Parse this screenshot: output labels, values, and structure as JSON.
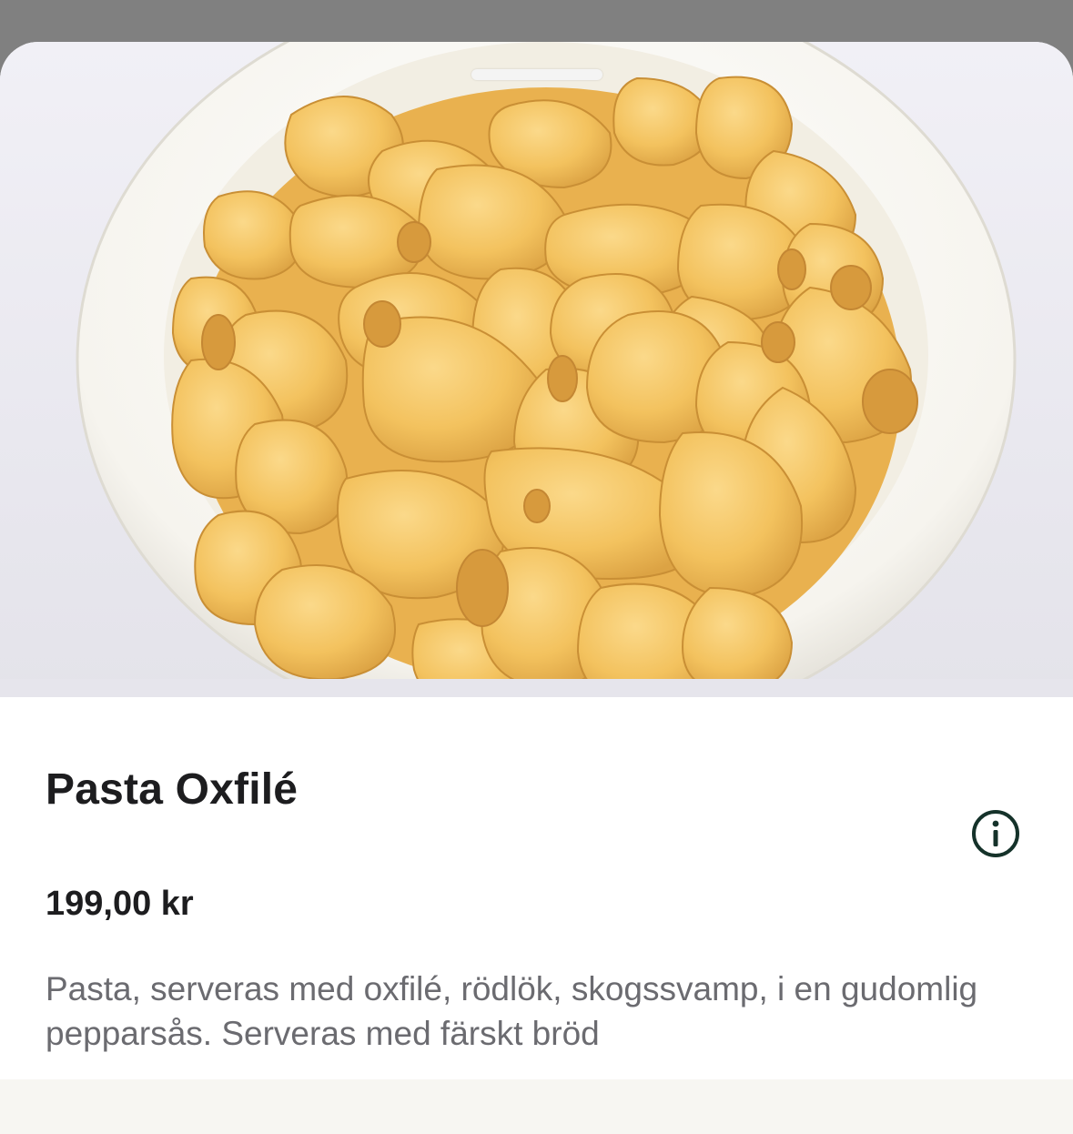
{
  "product": {
    "image_alt": "Skål med pasta",
    "title": "Pasta Oxfilé",
    "price": "199,00 kr",
    "description": "Pasta, serveras med oxfilé, rödlök, skogssvamp, i en gudomlig pepparsås. Serveras med färskt bröd"
  },
  "icons": {
    "info": "info-icon"
  },
  "colors": {
    "backdrop": "#808080",
    "sheet": "#ffffff",
    "text_primary": "#1d1d1f",
    "text_secondary": "#6b6b70",
    "icon_outline": "#15322a",
    "footer": "#f7f6f2"
  }
}
